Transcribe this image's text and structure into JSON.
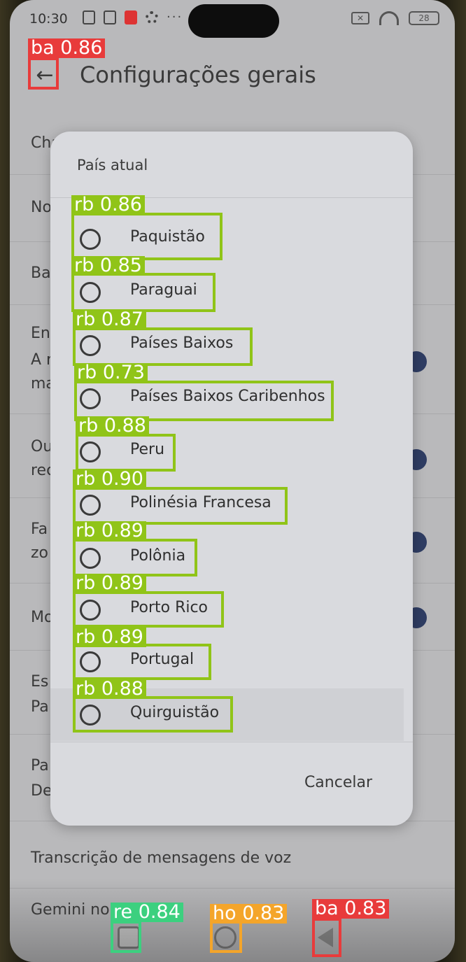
{
  "status_bar": {
    "time": "10:30",
    "battery": "28"
  },
  "header": {
    "title": "Configurações gerais"
  },
  "background_settings": [
    {
      "text": "Cha"
    },
    {
      "text": "No"
    },
    {
      "text": "Ba"
    },
    {
      "text": "En",
      "text2": "A r",
      "text3": "ma"
    },
    {
      "text": "Ou",
      "text2": "rec"
    },
    {
      "text": "Fa",
      "text2": "zo"
    },
    {
      "text": "Mo"
    },
    {
      "text": "Es",
      "text2": "Pa"
    },
    {
      "text": "Pa",
      "text2": "De"
    },
    {
      "text": "Transcrição de mensagens de voz"
    },
    {
      "text": "Gemini no"
    }
  ],
  "dialog": {
    "title": "País atual",
    "options": [
      "Paquistão",
      "Paraguai",
      "Países Baixos",
      "Países Baixos Caribenhos",
      "Peru",
      "Polinésia Francesa",
      "Polônia",
      "Porto Rico",
      "Portugal",
      "Quirguistão"
    ],
    "cancel_label": "Cancelar"
  },
  "detections": [
    {
      "label": "ba 0.86",
      "color": "#e83b3b"
    },
    {
      "label": "rb 0.86",
      "color": "#90c418"
    },
    {
      "label": "rb 0.85",
      "color": "#90c418"
    },
    {
      "label": "rb 0.87",
      "color": "#90c418"
    },
    {
      "label": "rb 0.73",
      "color": "#90c418"
    },
    {
      "label": "rb 0.88",
      "color": "#90c418"
    },
    {
      "label": "rb 0.90",
      "color": "#90c418"
    },
    {
      "label": "rb 0.89",
      "color": "#90c418"
    },
    {
      "label": "rb 0.89",
      "color": "#90c418"
    },
    {
      "label": "rb 0.89",
      "color": "#90c418"
    },
    {
      "label": "rb 0.88",
      "color": "#90c418"
    },
    {
      "label": "re 0.84",
      "color": "#3cd07f"
    },
    {
      "label": "ho 0.83",
      "color": "#f4a52a"
    },
    {
      "label": "ba 0.83",
      "color": "#e83b3b"
    }
  ],
  "nav_bar": {
    "recents_icon": "square-icon",
    "home_icon": "circle-icon",
    "back_icon": "triangle-back-icon"
  }
}
